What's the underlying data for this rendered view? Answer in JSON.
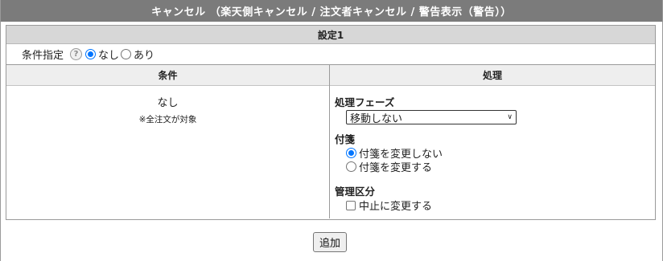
{
  "title": "キャンセル （楽天側キャンセル / 注文者キャンセル / 警告表示（警告））",
  "setting": {
    "header": "設定1",
    "condition_spec": {
      "label": "条件指定",
      "help_icon": "?",
      "options": [
        {
          "label": "なし",
          "checked": true
        },
        {
          "label": "あり",
          "checked": false
        }
      ]
    },
    "columns": {
      "condition": "条件",
      "process": "処理"
    },
    "condition": {
      "value": "なし",
      "note": "※全注文が対象"
    },
    "process": {
      "phase": {
        "label": "処理フェーズ",
        "selected": "移動しない"
      },
      "tag": {
        "label": "付箋",
        "options": [
          {
            "label": "付箋を変更しない",
            "checked": true
          },
          {
            "label": "付箋を変更する",
            "checked": false
          }
        ]
      },
      "management": {
        "label": "管理区分",
        "checkbox_label": "中止に変更する",
        "checked": false
      }
    }
  },
  "add_button": "追加",
  "colors": {
    "title_bg": "#7b7b7b",
    "header_bg": "#d7d7d7",
    "col_head_bg": "#eeeeee",
    "radio_accent": "#0075ff"
  }
}
